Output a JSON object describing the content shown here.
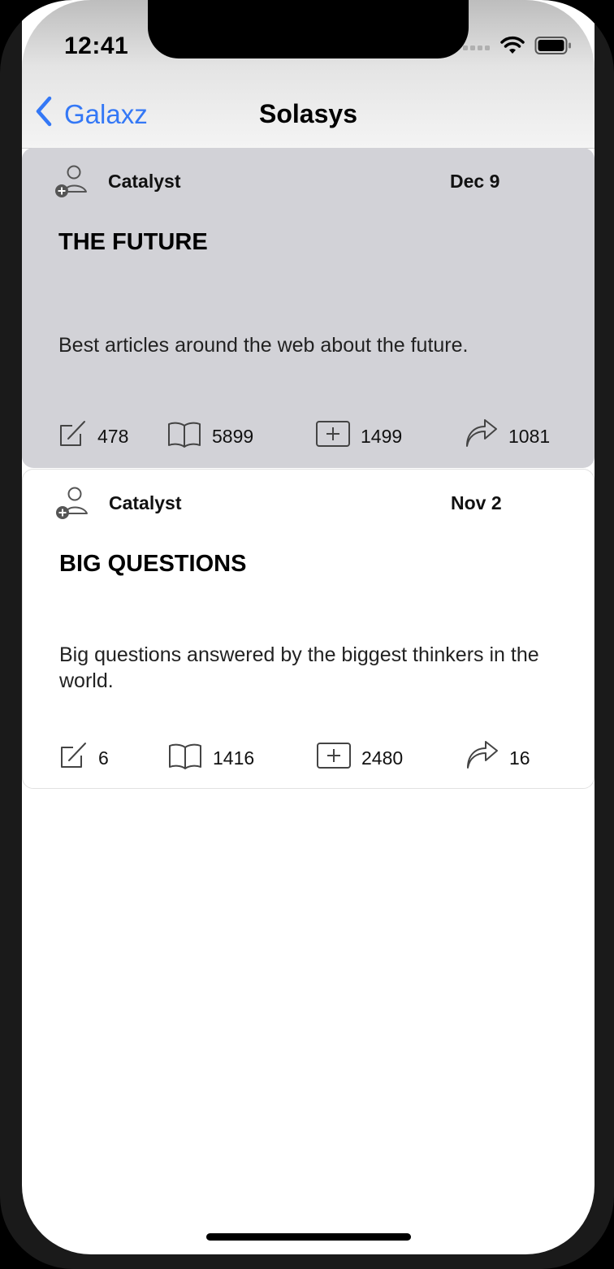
{
  "status_bar": {
    "time": "12:41"
  },
  "nav": {
    "back_label": "Galaxz",
    "title": "Solasys"
  },
  "cards": [
    {
      "author": "Catalyst",
      "date": "Dec 9",
      "title": "THE FUTURE",
      "description": "Best articles around the web about the future.",
      "stats": {
        "edits": "478",
        "reads": "5899",
        "adds": "1499",
        "shares": "1081"
      }
    },
    {
      "author": "Catalyst",
      "date": "Nov 2",
      "title": "BIG QUESTIONS",
      "description": "Big questions answered by the biggest thinkers in the world.",
      "stats": {
        "edits": "6",
        "reads": "1416",
        "adds": "2480",
        "shares": "16"
      }
    }
  ],
  "colors": {
    "accent": "#3478f6",
    "selected_card": "#d2d2d7"
  }
}
